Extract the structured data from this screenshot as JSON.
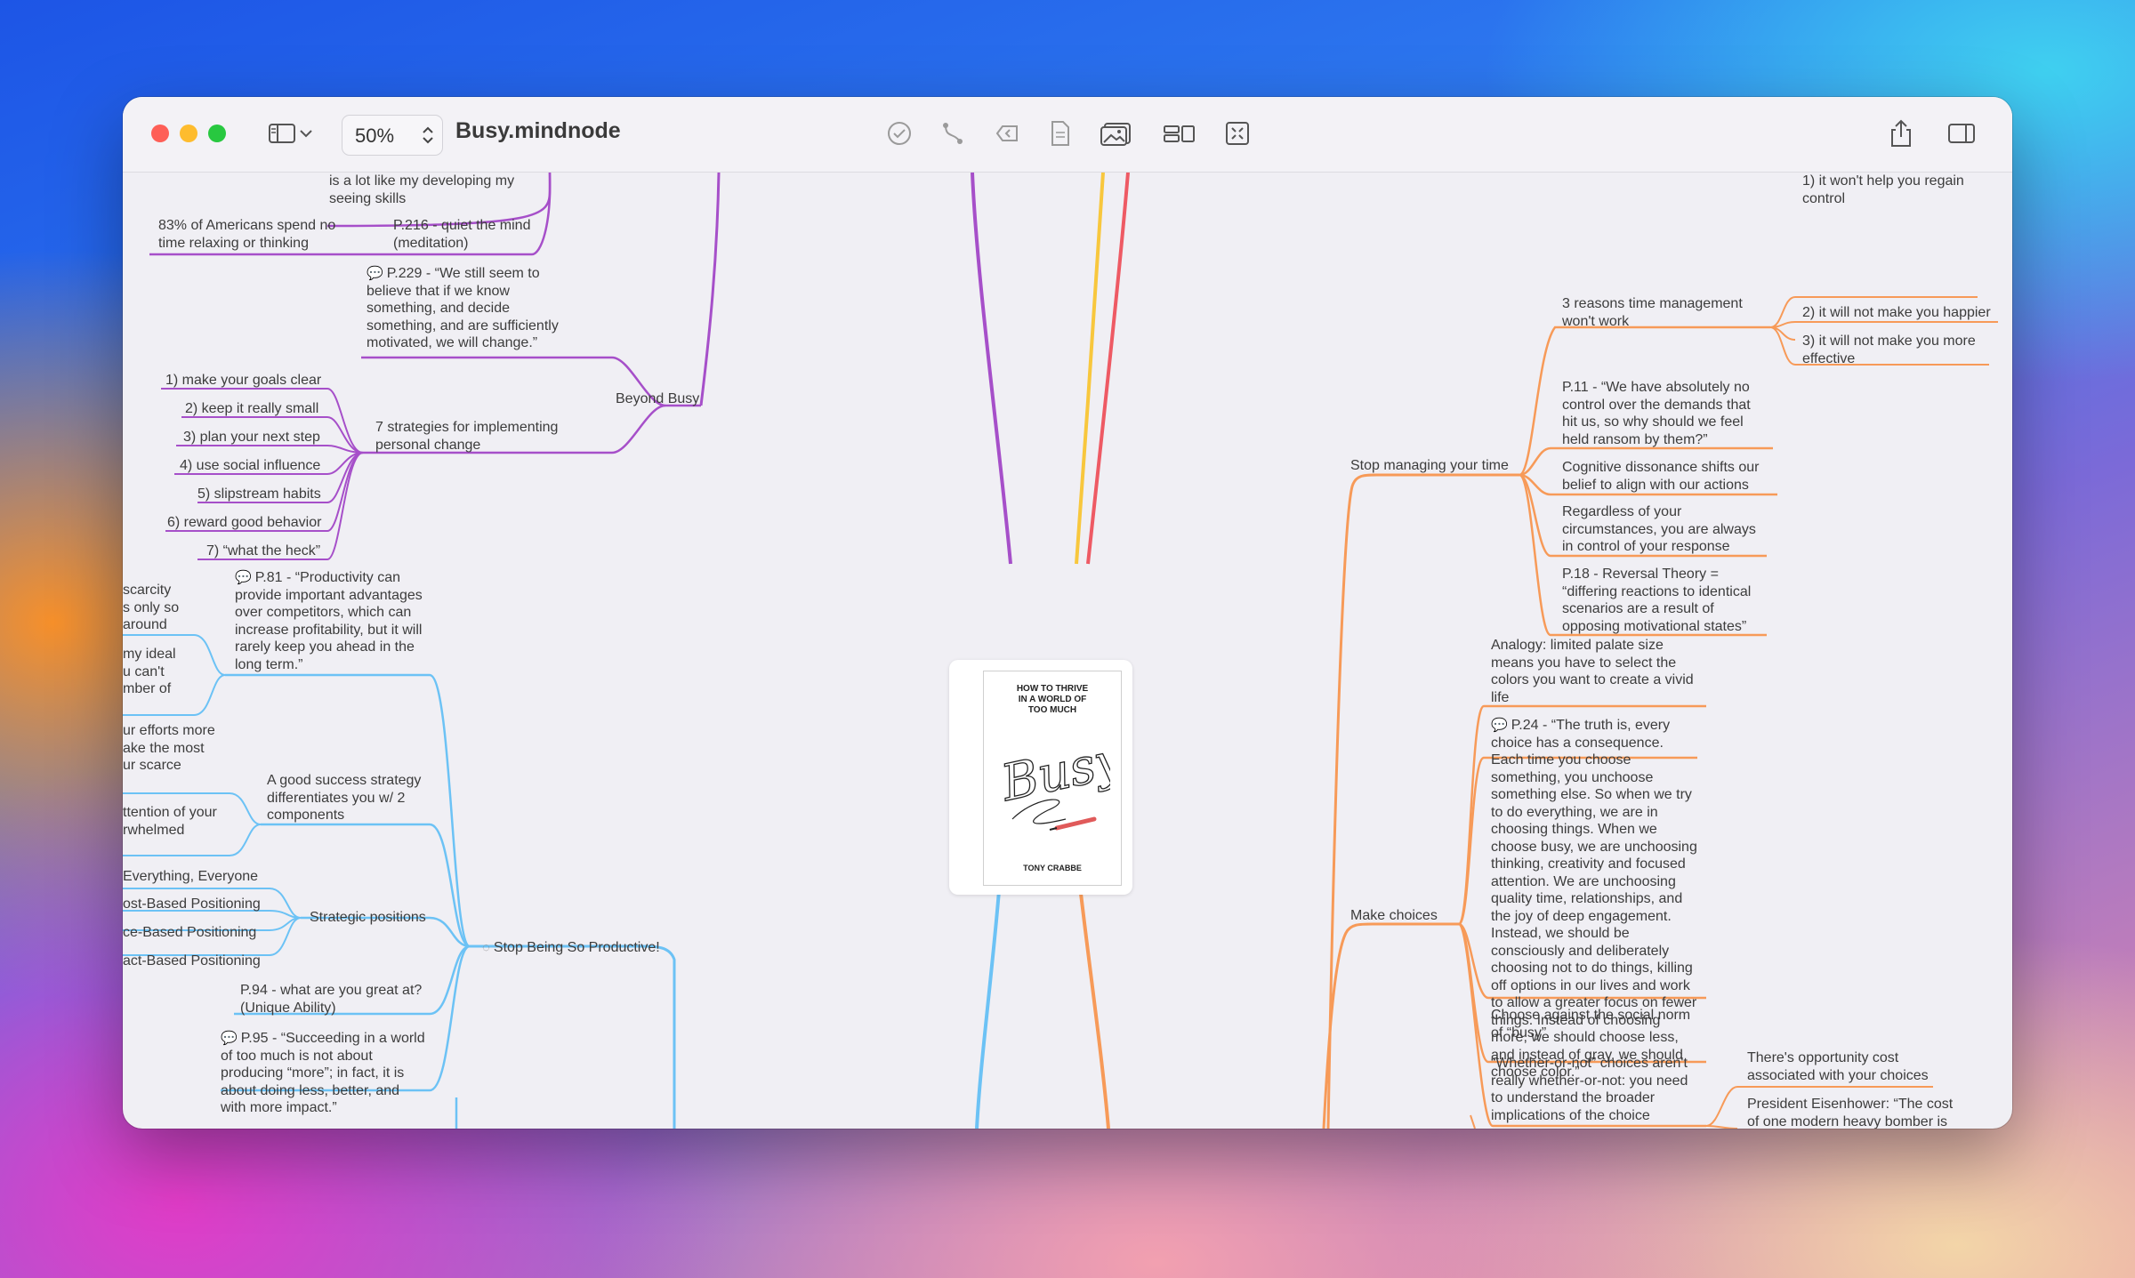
{
  "window": {
    "title": "Busy.mindnode",
    "zoom": "50%"
  },
  "toolbar": {
    "icons": [
      "sidebar-icon",
      "chevron-down-icon",
      "checkmark-circle-icon",
      "connection-icon",
      "back-circle-icon",
      "document-icon",
      "image-icon",
      "layout-icon",
      "focus-icon",
      "share-icon",
      "inspector-icon"
    ]
  },
  "center": {
    "cover_title": "HOW TO THRIVE\nIN A WORLD OF\nTOO MUCH",
    "cover_script": "Busy",
    "author": "TONY CRABBE"
  },
  "nodes": {
    "p1": "is a lot like my developing my\nseeing skills",
    "p2": "83% of Americans spend no\ntime relaxing or thinking",
    "p3": "P.216 - quiet the mind\n(meditation)",
    "p4": "P.229 - “We still seem to\nbelieve that if we know\nsomething, and decide\nsomething, and are sufficiently\nmotivated, we will change.”",
    "p5": "Beyond Busy",
    "p6": "7 strategies for implementing\npersonal change",
    "s1": "1) make your goals clear",
    "s2": "2) keep it really small",
    "s3": "3) plan your next step",
    "s4": "4) use social influence",
    "s5": "5) slipstream habits",
    "s6": "6) reward good behavior",
    "s7": "7) “what the heck”",
    "b1": "P.81 - “Productivity can\nprovide important advantages\nover competitors, which can\nincrease profitability, but it will\nrarely keep you ahead in the\nlong term.”",
    "b2": "scarcity\ns only so\n around",
    "b3": "my ideal\nu can't\nmber of",
    "b4": "ur efforts more\nake the most\nur scarce",
    "b5": "A good success strategy\ndifferentiates you w/ 2\ncomponents",
    "b6": "ttention of your\nrwhelmed",
    "b7": "Everything, Everyone",
    "b8": "ost-Based Positioning",
    "b9": "ce-Based Positioning",
    "b10": "act-Based Positioning",
    "b11": "Strategic positions",
    "b12": "Stop Being So Productive!",
    "b13": "P.94 - what are you great at?\n(Unique Ability)",
    "b14": "P.95 - “Succeeding in a world\nof too much is not about\nproducing “more”; in fact, it is\nabout doing less, better, and\nwith more impact.”",
    "o1": "1) it won't help you regain\ncontrol",
    "o2": "3 reasons time management\nwon't work",
    "o3": "2) it will not make you happier",
    "o4": "3) it will not make you more\neffective",
    "o5": "P.11 - “We have absolutely no\ncontrol over the demands that\nhit us, so why should we feel\nheld ransom by them?”",
    "o6": "Stop managing your time",
    "o7": "Cognitive dissonance shifts our\nbelief to align with our actions",
    "o8": "Regardless of your\ncircumstances, you are always\nin control of your response",
    "o9": "P.18 - Reversal Theory =\n“differing reactions to identical\nscenarios are a result of\nopposing motivational states”",
    "o10": "Analogy: limited palate size\nmeans you have to select the\ncolors you want to create a vivid\nlife",
    "o11": "P.24 - “The truth is, every\nchoice has a consequence.\nEach time you choose\nsomething, you unchoose\nsomething else. So when we try\nto do everything, we are in\nchoosing things. When we\nchoose busy, we are unchoosing\nthinking, creativity and focused\nattention. We are unchoosing\nquality time, relationships, and\nthe joy of deep engagement.\nInstead, we should be\nconsciously and deliberately\nchoosing not to do things, killing\noff options in our lives and work\nto allow a greater focus on fewer\nthings. Instead of choosing\nmore, we should choose less,\nand instead of gray, we should\nchoose color.”",
    "o12": "Make choices",
    "o13": "Choose against the social norm\nof “busy”",
    "o14": "“Whether-or-not” choices aren't\nreally whether-or-not: you need\nto understand the broader\nimplications of the choice",
    "o15": "There's opportunity cost\nassociated with your choices",
    "o16": "President Eisenhower: “The cost\nof one modern heavy bomber is"
  },
  "colors": {
    "purple": "#a64fc9",
    "blue": "#6cc2f5",
    "orange": "#f79a58",
    "yellow": "#f8c73d",
    "red": "#ee5a64"
  }
}
